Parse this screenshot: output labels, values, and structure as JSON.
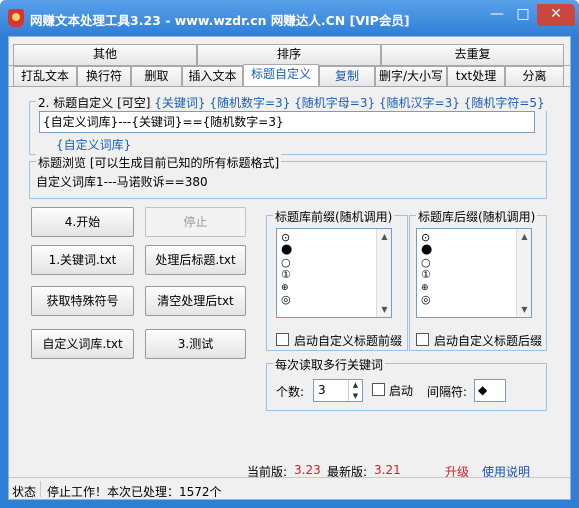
{
  "window": {
    "title": "网赚文本处理工具3.23 - www.wzdr.cn 网赚达人.CN [VIP会员]",
    "controls": {
      "minimize": "—",
      "maximize": "□",
      "close": "✕"
    }
  },
  "tabs": {
    "row1": [
      "其他",
      "排序",
      "去重复"
    ],
    "row2": [
      "打乱文本",
      "换行符",
      "删取",
      "插入文本",
      "标题自定义",
      "复制",
      "删字/大小写",
      "txt处理",
      "分离"
    ],
    "active": "标题自定义"
  },
  "title_custom": {
    "legend_prefix": "2. 标题自定义 [可空]",
    "legend_tokens": "{关键词} {随机数字=3} {随机字母=3} {随机汉字=3} {随机字符=5}",
    "input_value": "{自定义词库}---{关键词}=={随机数字=3}",
    "extra_token": "{自定义词库}"
  },
  "preview": {
    "legend": "标题浏览 [可以生成目前已知的所有标题格式]",
    "text": "自定义词库1---马诺败诉==380"
  },
  "buttons": {
    "start": "4.开始",
    "stop": "停止",
    "keywords_txt": "1.关键词.txt",
    "processed_txt": "处理后标题.txt",
    "get_special": "获取特殊符号",
    "clear_processed": "清空处理后txt",
    "custom_lib_txt": "自定义词库.txt",
    "test": "3.测试"
  },
  "prefix_lib": {
    "legend": "标题库前缀(随机调用)",
    "items": [
      "⊙",
      "●",
      "○",
      "①",
      "⊕",
      "◎"
    ],
    "checkbox_label": "启动自定义标题前缀",
    "checked": false
  },
  "suffix_lib": {
    "legend": "标题库后缀(随机调用)",
    "items": [
      "⊙",
      "●",
      "○",
      "①",
      "⊕",
      "◎"
    ],
    "checkbox_label": "启动自定义标题后缀",
    "checked": false
  },
  "multi_keywords": {
    "legend": "每次读取多行关键词",
    "count_label": "个数:",
    "count_value": "3",
    "enable_label": "启动",
    "enabled": false,
    "separator_label": "间隔符:",
    "separator_value": "◆"
  },
  "version": {
    "current_label": "当前版:",
    "current_value": "3.23",
    "latest_label": "最新版:",
    "latest_value": "3.21",
    "upgrade": "升级",
    "help": "使用说明"
  },
  "status": {
    "label": "状态",
    "message": "停止工作！本次已处理：1572个"
  },
  "colors": {
    "titlebar": "#2f7fd6",
    "accent_blue": "#1a5fb4",
    "version_red": "#d62020"
  }
}
